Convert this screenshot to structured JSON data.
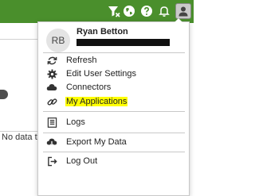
{
  "topbar": {
    "icons": [
      "filter-icon",
      "globe-icon",
      "help-icon",
      "bell-icon"
    ],
    "account_icon": "person-icon"
  },
  "background": {
    "no_data_text": "No data to d"
  },
  "account_menu": {
    "avatar_initials": "RB",
    "user_name": "Ryan Betton",
    "items": [
      {
        "label": "Refresh",
        "icon": "refresh-icon"
      },
      {
        "label": "Edit User Settings",
        "icon": "gear-icon"
      },
      {
        "label": "Connectors",
        "icon": "cloud-icon"
      },
      {
        "label": "My Applications",
        "icon": "link-icon",
        "highlighted": true
      },
      {
        "label": "Logs",
        "icon": "log-icon"
      },
      {
        "label": "Export My Data",
        "icon": "cloud-download-icon"
      },
      {
        "label": "Log Out",
        "icon": "logout-icon"
      }
    ],
    "highlight_color": "#ffff00"
  }
}
